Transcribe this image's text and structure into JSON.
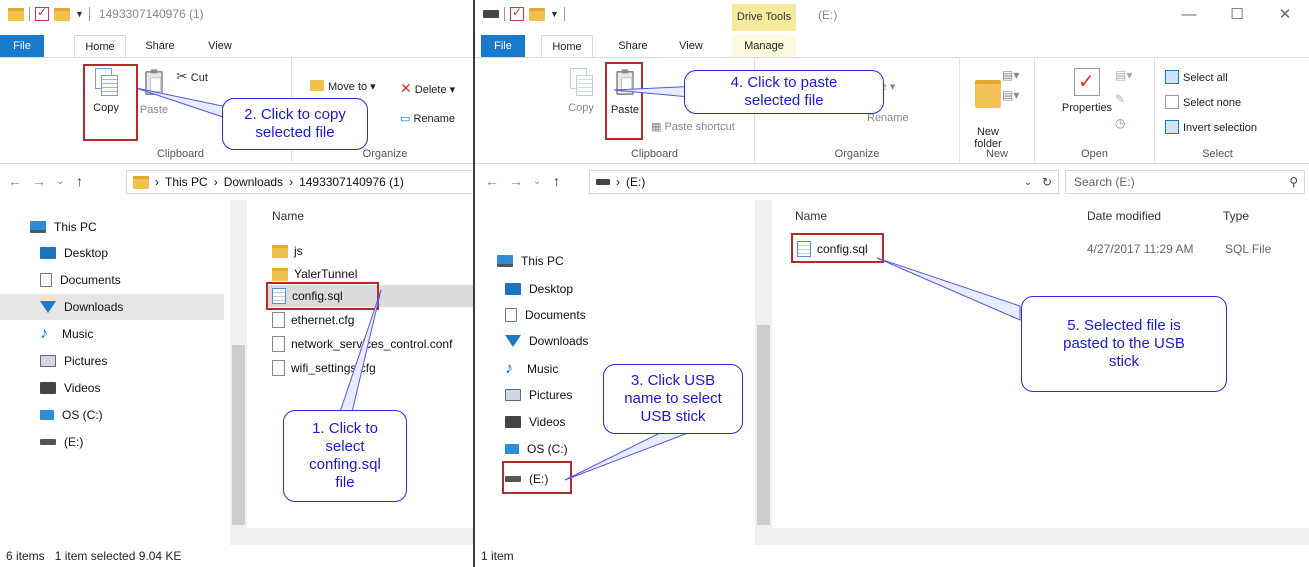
{
  "left": {
    "title": "1493307140976 (1)",
    "tabs": [
      "File",
      "Home",
      "Share",
      "View"
    ],
    "ribbon": {
      "copy": "Copy",
      "paste": "Paste",
      "cut": "Cut",
      "move_to": "Move to ▾",
      "delete": "Delete ▾",
      "rename": "Rename",
      "clipboard_group": "Clipboard",
      "organize_group": "Organize"
    },
    "address": {
      "crumbs": [
        "This PC",
        "Downloads",
        "1493307140976 (1)"
      ]
    },
    "nav": [
      "This PC",
      "Desktop",
      "Documents",
      "Downloads",
      "Music",
      "Pictures",
      "Videos",
      "OS (C:)",
      "(E:)"
    ],
    "columns": {
      "name": "Name"
    },
    "files": [
      {
        "name": "js",
        "type": "folder"
      },
      {
        "name": "YalerTunnel",
        "type": "folder"
      },
      {
        "name": "config.sql",
        "type": "sql"
      },
      {
        "name": "ethernet.cfg",
        "type": "file"
      },
      {
        "name": "network_services_control.conf",
        "type": "file"
      },
      {
        "name": "wifi_settings.cfg",
        "type": "file"
      }
    ],
    "status": {
      "items": "6 items",
      "selected": "1 item selected  9.04 KE"
    }
  },
  "right": {
    "title": "(E:)",
    "context_tab": "Drive Tools",
    "tabs": [
      "File",
      "Home",
      "Share",
      "View",
      "Manage"
    ],
    "ribbon": {
      "copy": "Copy",
      "paste": "Paste",
      "paste_shortcut": "Paste shortcut",
      "delete": "Delete ▾",
      "rename": "Rename",
      "new_folder": "New\nfolder",
      "properties": "Properties",
      "select_all": "Select all",
      "select_none": "Select none",
      "invert_selection": "Invert selection",
      "groups": [
        "Clipboard",
        "Organize",
        "New",
        "Open",
        "Select"
      ]
    },
    "address": {
      "crumbs": [
        "(E:)"
      ]
    },
    "search_placeholder": "Search (E:)",
    "nav": [
      "This PC",
      "Desktop",
      "Documents",
      "Downloads",
      "Music",
      "Pictures",
      "Videos",
      "OS (C:)",
      "(E:)"
    ],
    "columns": {
      "name": "Name",
      "date": "Date modified",
      "type": "Type"
    },
    "files": [
      {
        "name": "config.sql",
        "date": "4/27/2017 11:29 AM",
        "type": "SQL File"
      }
    ],
    "status": {
      "items": "1 item"
    }
  },
  "callouts": {
    "c1": "1. Click to\nselect\nconfing.sql\nfile",
    "c2": "2. Click to copy\nselected file",
    "c3": "3. Click USB\nname to select\nUSB stick",
    "c4": "4. Click to paste\nselected file",
    "c5": "5. Selected file is\npasted to the USB\nstick"
  },
  "colors": {
    "accent": "#1979ca",
    "highlight": "#b62a2a",
    "callout": "#2a2ae0",
    "drive_tools": "#f5ea9e"
  }
}
